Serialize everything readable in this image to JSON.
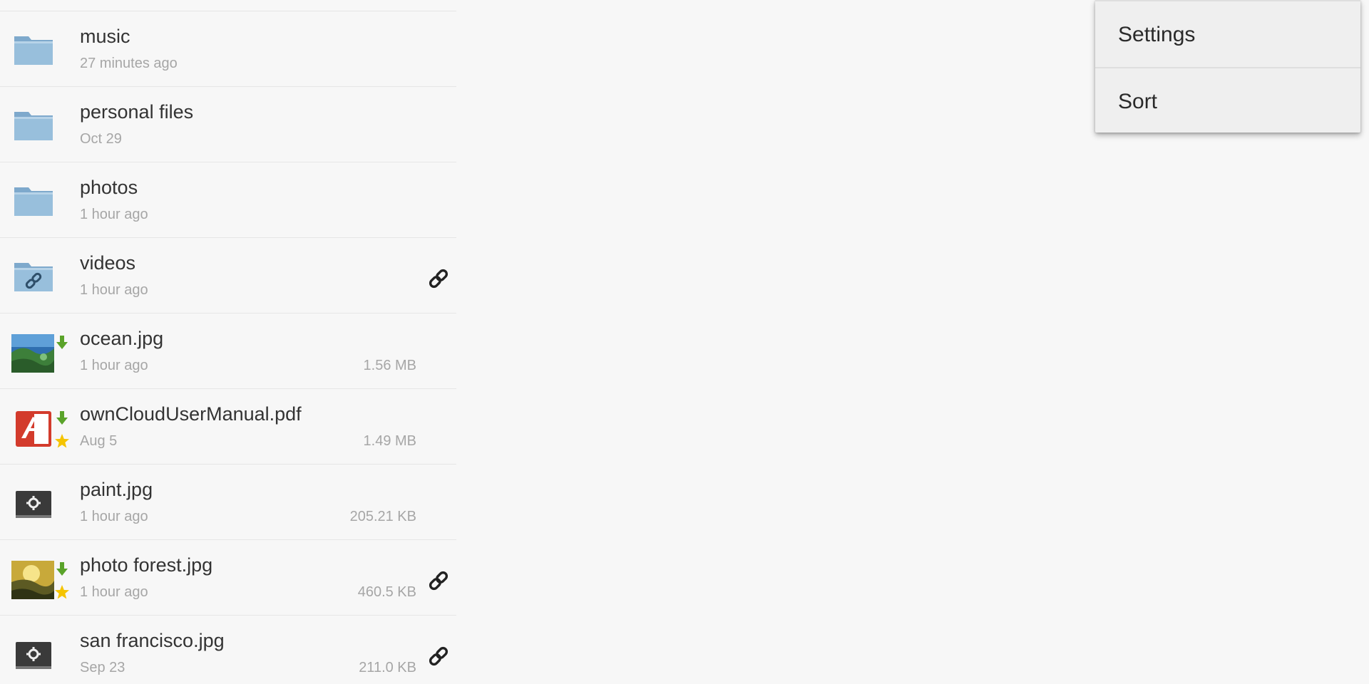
{
  "files": [
    {
      "name": "music",
      "meta": "27 minutes ago",
      "size": "",
      "icon": "folder-icon",
      "shared": false,
      "downloaded": false,
      "favorite": false
    },
    {
      "name": "personal files",
      "meta": "Oct 29",
      "size": "",
      "icon": "folder-icon",
      "shared": false,
      "downloaded": false,
      "favorite": false
    },
    {
      "name": "photos",
      "meta": "1 hour ago",
      "size": "",
      "icon": "folder-icon",
      "shared": false,
      "downloaded": false,
      "favorite": false
    },
    {
      "name": "videos",
      "meta": "1 hour ago",
      "size": "",
      "icon": "shared-folder-icon",
      "shared": true,
      "downloaded": false,
      "favorite": false
    },
    {
      "name": "ocean.jpg",
      "meta": "1 hour ago",
      "size": "1.56 MB",
      "icon": "ocean-image-thumbnail",
      "shared": false,
      "downloaded": true,
      "favorite": false
    },
    {
      "name": "ownCloudUserManual.pdf",
      "meta": "Aug 5",
      "size": "1.49 MB",
      "icon": "pdf-file-icon",
      "shared": false,
      "downloaded": true,
      "favorite": true
    },
    {
      "name": "paint.jpg",
      "meta": "1 hour ago",
      "size": "205.21 KB",
      "icon": "image-file-icon",
      "shared": false,
      "downloaded": false,
      "favorite": false
    },
    {
      "name": "photo forest.jpg",
      "meta": "1 hour ago",
      "size": "460.5 KB",
      "icon": "forest-image-thumbnail",
      "shared": true,
      "downloaded": true,
      "favorite": true
    },
    {
      "name": "san francisco.jpg",
      "meta": "Sep 23",
      "size": "211.0 KB",
      "icon": "image-file-icon",
      "shared": true,
      "downloaded": false,
      "favorite": false
    }
  ],
  "menu": {
    "items": [
      {
        "label": "Settings"
      },
      {
        "label": "Sort"
      }
    ]
  },
  "colors": {
    "folder": "#8fb6d6",
    "download_badge": "#5aa32a",
    "favorite_badge": "#f5c400",
    "pdf_red": "#d33b2c"
  }
}
